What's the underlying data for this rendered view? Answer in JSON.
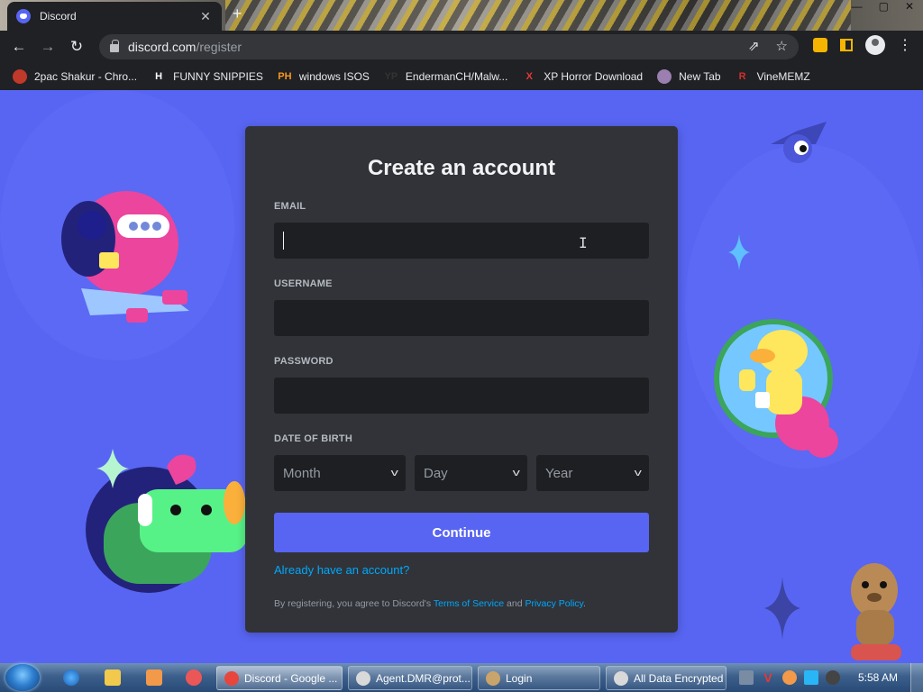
{
  "browser": {
    "tab_title": "Discord",
    "tab_close": "✕",
    "new_tab": "+",
    "url_host": "discord.com",
    "url_path": "/register",
    "bookmarks": [
      {
        "label": "2pac Shakur - Chro...",
        "icon_text": "",
        "icon_color": "#c0392b"
      },
      {
        "label": "FUNNY SNIPPIES",
        "icon_text": "H",
        "icon_color": "#ffffff"
      },
      {
        "label": "windows ISOS",
        "icon_text": "PH",
        "icon_color": "#f7971d"
      },
      {
        "label": "EndermanCH/Malw...",
        "icon_text": "YP",
        "icon_color": "#333333"
      },
      {
        "label": "XP Horror Download",
        "icon_text": "X",
        "icon_color": "#e53935"
      },
      {
        "label": "New Tab",
        "icon_text": "",
        "icon_color": "#9a7fb0"
      },
      {
        "label": "VineMEMZ",
        "icon_text": "R",
        "icon_color": "#d32f2f"
      }
    ]
  },
  "auth": {
    "title": "Create an account",
    "email_label": "EMAIL",
    "email_value": "",
    "username_label": "USERNAME",
    "username_value": "",
    "password_label": "PASSWORD",
    "password_value": "",
    "dob_label": "DATE OF BIRTH",
    "dob": {
      "month": "Month",
      "day": "Day",
      "year": "Year"
    },
    "continue_label": "Continue",
    "login_link": "Already have an account?",
    "legal_prefix": "By registering, you agree to Discord's ",
    "tos_link": "Terms of Service",
    "legal_and": " and ",
    "privacy_link": "Privacy Policy",
    "legal_suffix": "."
  },
  "taskbar": {
    "tasks": [
      {
        "label": "Discord - Google ...",
        "active": true,
        "icon_color": "#e8453c"
      },
      {
        "label": "Agent.DMR@prot...",
        "active": false,
        "icon_color": "#d9d9d9"
      },
      {
        "label": "Login",
        "active": false,
        "icon_color": "#c9a46b"
      },
      {
        "label": "All Data Encrypted",
        "active": false,
        "icon_color": "#d9d9d9"
      }
    ],
    "clock": "5:58 AM"
  },
  "colors": {
    "brand": "#5865f2",
    "card_bg": "#313338",
    "input_bg": "#1e1f22",
    "link": "#00a8fc"
  }
}
